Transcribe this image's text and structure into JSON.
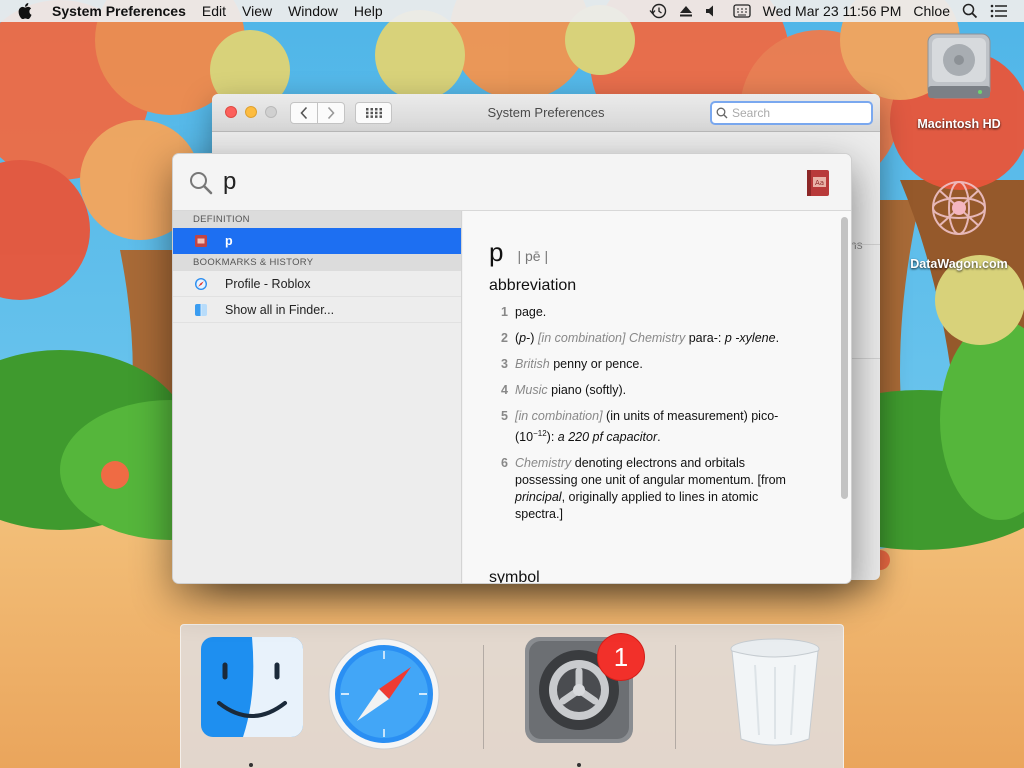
{
  "menubar": {
    "app_name": "System Preferences",
    "menus": [
      "Edit",
      "View",
      "Window",
      "Help"
    ],
    "clock": "Wed Mar 23  11:56 PM",
    "user": "Chloe"
  },
  "desktop": {
    "icons": [
      {
        "label": "Macintosh HD",
        "icon": "hard-drive-icon"
      },
      {
        "label": "DataWagon.com",
        "icon": "network-icon"
      }
    ]
  },
  "sysprefs": {
    "title": "System Preferences",
    "search_placeholder": "Search",
    "partial_text": "ns"
  },
  "spotlight": {
    "query": "p",
    "sections": [
      {
        "label": "DEFINITION"
      },
      {
        "label": "BOOKMARKS & HISTORY"
      }
    ],
    "results": {
      "definition": [
        {
          "label": "p",
          "selected": true,
          "icon": "dictionary-icon"
        }
      ],
      "bookmarks": [
        {
          "label": "Profile - Roblox",
          "icon": "safari-icon"
        },
        {
          "label": "Show all in Finder...",
          "icon": "finder-icon"
        }
      ]
    },
    "definition": {
      "word": "p",
      "pronunciation": "| pē |",
      "part_of_speech": "abbreviation",
      "senses": [
        {
          "num": "1",
          "text": "page."
        },
        {
          "num": "2",
          "pre": "(",
          "pre_it": "p",
          "mid": "-) ",
          "label": "[in combination] Chemistry",
          "text": " para-: ",
          "example": "p -xylene",
          "end": "."
        },
        {
          "num": "3",
          "label": "British",
          "text": " penny or pence."
        },
        {
          "num": "4",
          "label": "Music",
          "text": " piano (softly)."
        },
        {
          "num": "5",
          "label": "[in combination]",
          "text": " (in units of measurement) pico- (10",
          "sup": "−12",
          "after": "): ",
          "example": "a 220 pf capacitor",
          "end": "."
        },
        {
          "num": "6",
          "label": "Chemistry",
          "text": " denoting electrons and orbitals possessing one unit of angular momentum. [from ",
          "example": "principal",
          "end": ", originally applied to lines in atomic spectra.]"
        }
      ],
      "next_heading": "symbol"
    }
  },
  "dock": {
    "items": [
      {
        "name": "Finder",
        "icon": "finder-icon"
      },
      {
        "name": "Safari",
        "icon": "safari-icon"
      },
      {
        "name": "System Preferences",
        "icon": "gear-icon",
        "badge": "1"
      },
      {
        "name": "Trash",
        "icon": "trash-icon"
      }
    ]
  },
  "colors": {
    "selection": "#1d6ff2",
    "badge": "#f2302a",
    "close": "#fc605c",
    "minimize": "#fdbc40"
  }
}
